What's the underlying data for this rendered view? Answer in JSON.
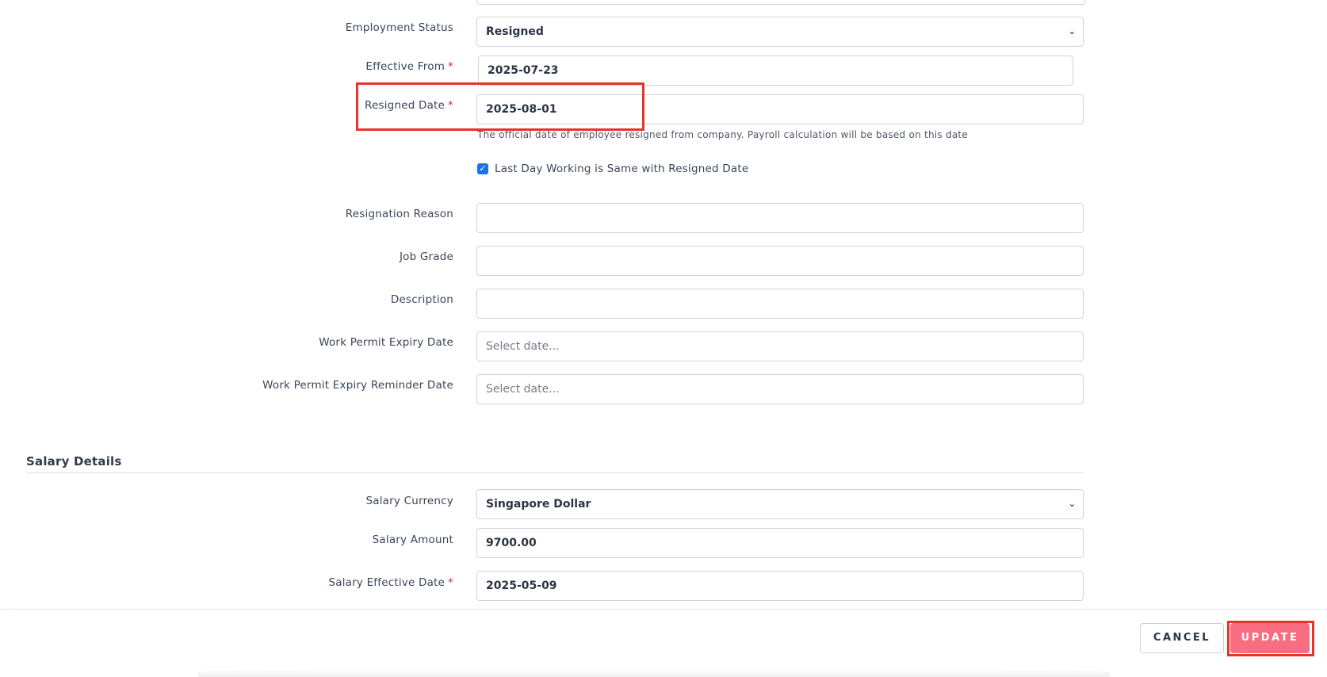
{
  "form": {
    "employment_status": {
      "label": "Employment Status",
      "value": "Resigned"
    },
    "effective_from": {
      "label": "Effective From",
      "required_mark": "*",
      "value": "2025-07-23"
    },
    "resigned_date": {
      "label": "Resigned Date",
      "required_mark": "*",
      "value": "2025-08-01",
      "hint": "The official date of employee resigned from company. Payroll calculation will be based on this date"
    },
    "last_day_checkbox": {
      "label": "Last Day Working is Same with Resigned Date",
      "checked": true,
      "check_glyph": "✓"
    },
    "resignation_reason": {
      "label": "Resignation Reason",
      "value": ""
    },
    "job_grade": {
      "label": "Job Grade",
      "value": ""
    },
    "description": {
      "label": "Description",
      "value": ""
    },
    "work_permit_expiry": {
      "label": "Work Permit Expiry Date",
      "placeholder": "Select date..."
    },
    "work_permit_reminder": {
      "label": "Work Permit Expiry Reminder Date",
      "placeholder": "Select date..."
    }
  },
  "salary": {
    "section_title": "Salary Details",
    "currency": {
      "label": "Salary Currency",
      "value": "Singapore Dollar"
    },
    "amount": {
      "label": "Salary Amount",
      "value": "9700.00"
    },
    "effective_date": {
      "label": "Salary Effective Date",
      "required_mark": "*",
      "value": "2025-05-09"
    }
  },
  "footer": {
    "cancel_label": "CANCEL",
    "update_label": "UPDATE"
  },
  "icons": {
    "select_chevron": "chevron-down-icon",
    "chevron_glyph": "⌄"
  },
  "colors": {
    "primary_button": "#f96d81",
    "required_mark": "#e0242a",
    "checkbox": "#1a73e8",
    "highlight_box": "#e8332a"
  }
}
